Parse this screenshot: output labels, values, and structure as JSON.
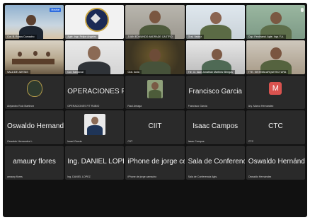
{
  "participants": [
    {
      "name": "Cor. B. Rosas Camacho",
      "kind": "video",
      "badge": "Mostrar"
    },
    {
      "name": "Agte. Ingr. Felipe Angeles",
      "kind": "video"
    },
    {
      "name": "JUAN EDMUNDO ANDRADE CASTRO",
      "kind": "video"
    },
    {
      "name": "Gral. Valdez",
      "kind": "video",
      "active": true
    },
    {
      "name": "Cap. Ferdinand. Agte. Ingr. F.A.",
      "kind": "video"
    },
    {
      "name": "SALA DE JUNTAS",
      "kind": "video"
    },
    {
      "name": "Cor. Sandoval",
      "kind": "video"
    },
    {
      "name": "Gral. Avila",
      "kind": "video"
    },
    {
      "name": "Tte. Cl. Alan Jonathan Martinez Bringas",
      "kind": "video"
    },
    {
      "name": "TTE. SISTEMA ARQUITECTURA",
      "kind": "video"
    },
    {
      "name": "Alejandro Ruiz Martinez",
      "kind": "logo",
      "display": ""
    },
    {
      "name": "OPERACIONES FIT RUBIO",
      "kind": "text",
      "display": "OPERACIONES FI..."
    },
    {
      "name": "Raul Arriaga",
      "kind": "photo",
      "display": ""
    },
    {
      "name": "Francisco Garcia",
      "kind": "text",
      "display": "Francisco Garcia"
    },
    {
      "name": "Ary. Marco Hernandez",
      "kind": "avatar",
      "display": "M"
    },
    {
      "name": "Oswaldo Hernandez L.",
      "kind": "text",
      "display": "Oswaldo Hernande..."
    },
    {
      "name": "Israel Garcia",
      "kind": "photo2",
      "display": ""
    },
    {
      "name": "CIIT",
      "kind": "text",
      "display": "CIIT"
    },
    {
      "name": "Isaac Campos",
      "kind": "text",
      "display": "Isaac Campos"
    },
    {
      "name": "CTC",
      "kind": "text",
      "display": "CTC"
    },
    {
      "name": "amaury flores",
      "kind": "text",
      "display": "amaury flores"
    },
    {
      "name": "Ing. DANIEL LOPEZ",
      "kind": "text",
      "display": "Ing. DANIEL LOPEZ"
    },
    {
      "name": "iPhone de jorge camacho",
      "kind": "text",
      "display": "iPhone de jorge ce..."
    },
    {
      "name": "Sala de Conferencia Agts.",
      "kind": "text",
      "display": "Sala de Conferenci..."
    },
    {
      "name": "Oswaldo Hernández",
      "kind": "text",
      "display": "Oswaldo Hernández"
    }
  ],
  "colors": {
    "background": "#111111",
    "tile": "#2a2a2a",
    "active_border": "#29c864",
    "avatar_m": "#d9534f",
    "badge": "#2d6cdf"
  },
  "icons": [
    "microphone-icon",
    "emblem-logo-icon"
  ]
}
